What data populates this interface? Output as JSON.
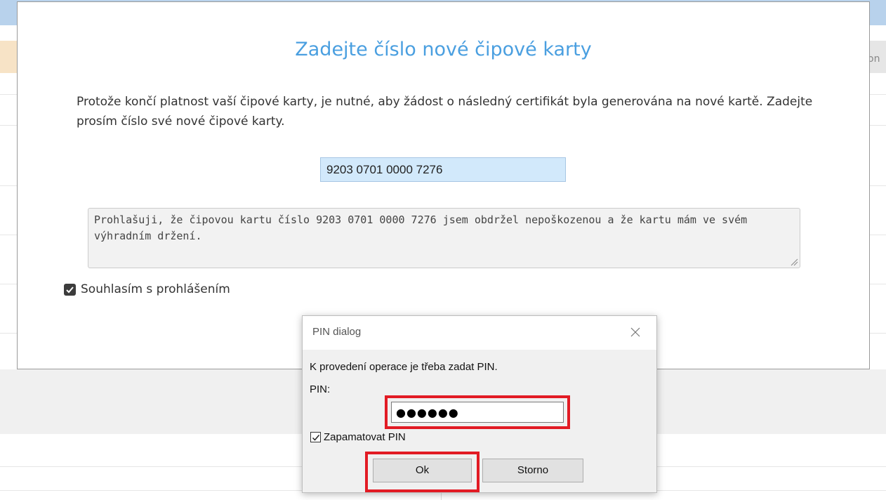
{
  "background": {
    "partial_header_text": "on"
  },
  "modal": {
    "title": "Zadejte číslo nové čipové karty",
    "description": "Protože končí platnost vaší čipové karty, je nutné, aby žádost o následný certifikát byla generována na nové kartě. Zadejte prosím číslo své nové čipové karty.",
    "card_number": "9203 0701 0000 7276",
    "declaration": "Prohlašuji, že čipovou kartu číslo 9203 0701 0000 7276 jsem obdržel nepoškozenou a že kartu mám ve svém výhradním držení.",
    "agree_label": "Souhlasím s prohlášením",
    "agree_checked": true,
    "title_color": "#4a9fe0"
  },
  "pin_dialog": {
    "title": "PIN dialog",
    "message": "K provedení operace je třeba zadat PIN.",
    "pin_label": "PIN:",
    "pin_masked": "●●●●●●",
    "remember_label": "Zapamatovat PIN",
    "remember_checked": true,
    "ok_label": "Ok",
    "cancel_label": "Storno",
    "highlight_color": "#e21b24"
  }
}
